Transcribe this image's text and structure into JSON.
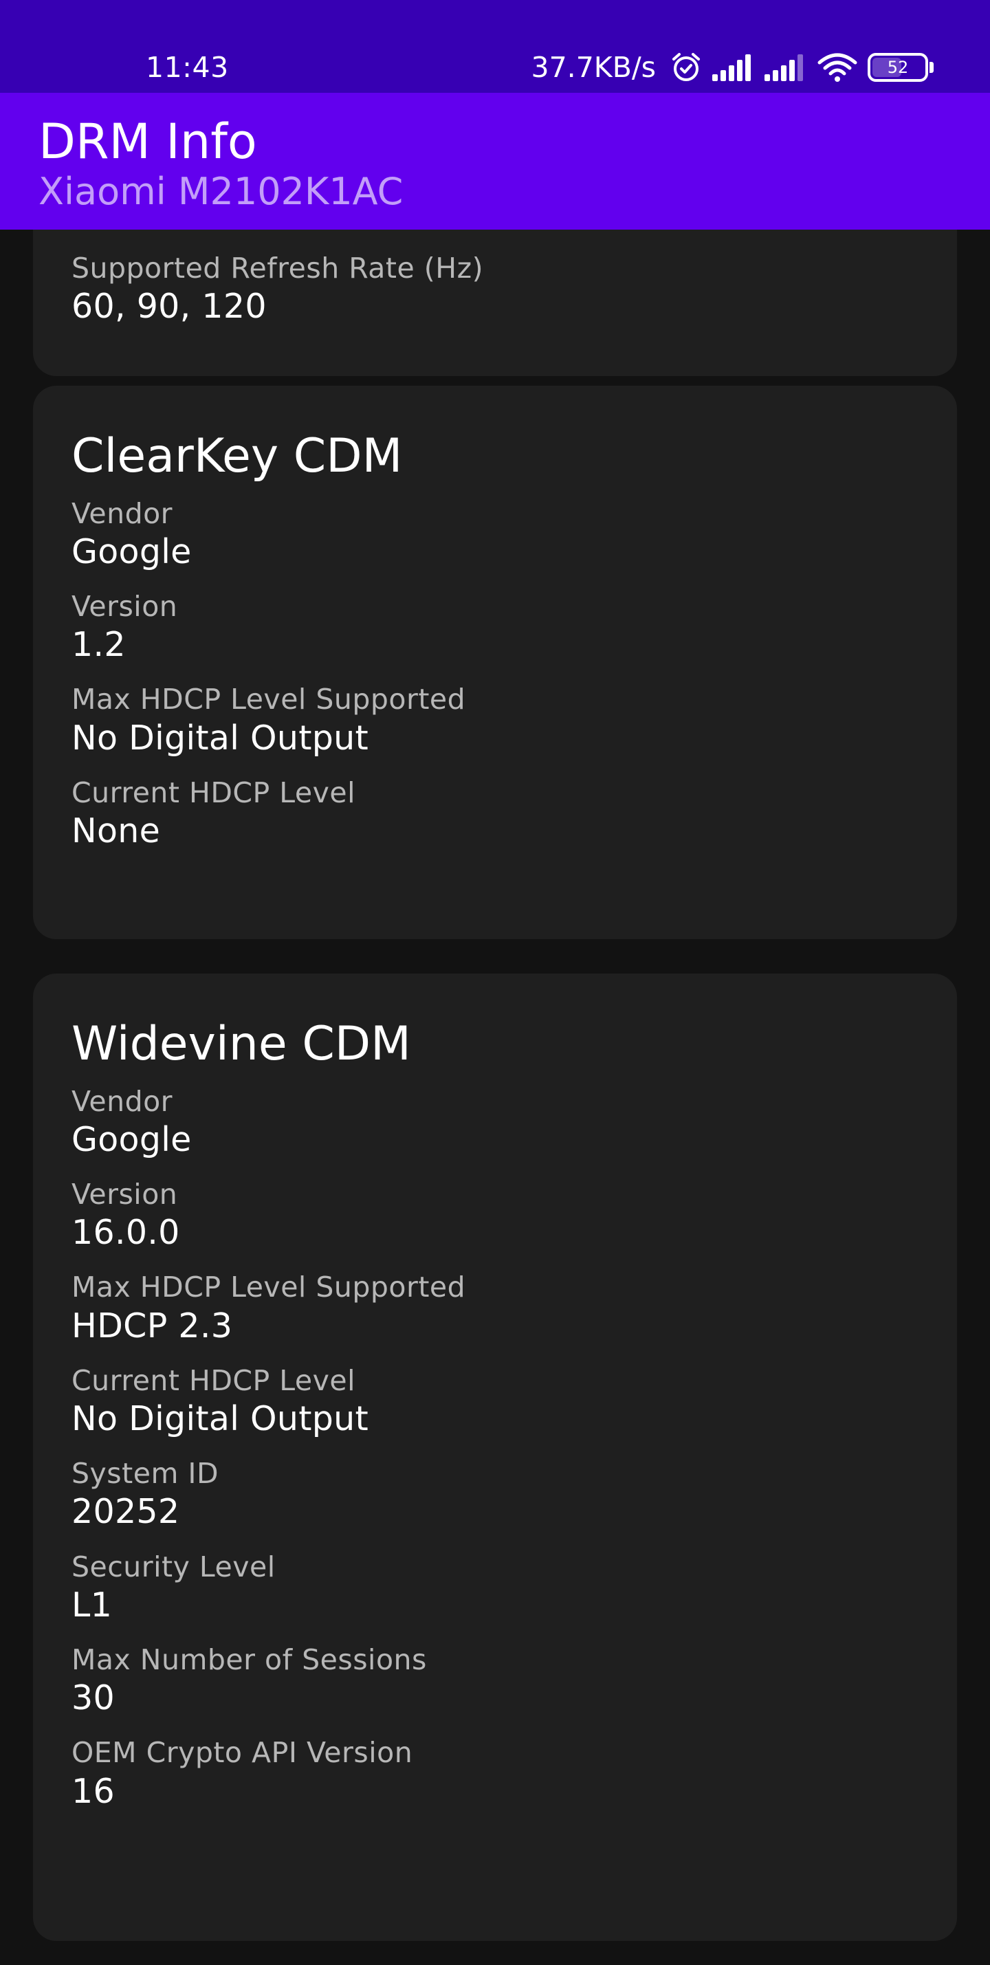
{
  "status_bar": {
    "time": "11:43",
    "net_speed": "37.7KB/s",
    "battery": "52",
    "icons": [
      "alarm-icon",
      "signal-icon",
      "signal-icon",
      "wifi-icon",
      "battery-icon"
    ]
  },
  "app_bar": {
    "title": "DRM Info",
    "subtitle": "Xiaomi M2102K1AC"
  },
  "display_card": {
    "fields": [
      {
        "label": "Supported Refresh Rate (Hz)",
        "value": "60, 90, 120"
      }
    ]
  },
  "clearkey_card": {
    "title": "ClearKey CDM",
    "fields": [
      {
        "label": "Vendor",
        "value": "Google"
      },
      {
        "label": "Version",
        "value": "1.2"
      },
      {
        "label": "Max HDCP Level Supported",
        "value": "No Digital Output"
      },
      {
        "label": "Current HDCP Level",
        "value": "None"
      }
    ]
  },
  "widevine_card": {
    "title": "Widevine CDM",
    "fields": [
      {
        "label": "Vendor",
        "value": "Google"
      },
      {
        "label": "Version",
        "value": "16.0.0"
      },
      {
        "label": "Max HDCP Level Supported",
        "value": "HDCP 2.3"
      },
      {
        "label": "Current HDCP Level",
        "value": "No Digital Output"
      },
      {
        "label": "System ID",
        "value": "20252"
      },
      {
        "label": "Security Level",
        "value": "L1"
      },
      {
        "label": "Max Number of Sessions",
        "value": "30"
      },
      {
        "label": "OEM Crypto API Version",
        "value": "16"
      }
    ]
  },
  "colors": {
    "status_bar": "#3700b3",
    "app_bar": "#6200ee",
    "background": "#121212",
    "card": "#1f1f1f"
  }
}
